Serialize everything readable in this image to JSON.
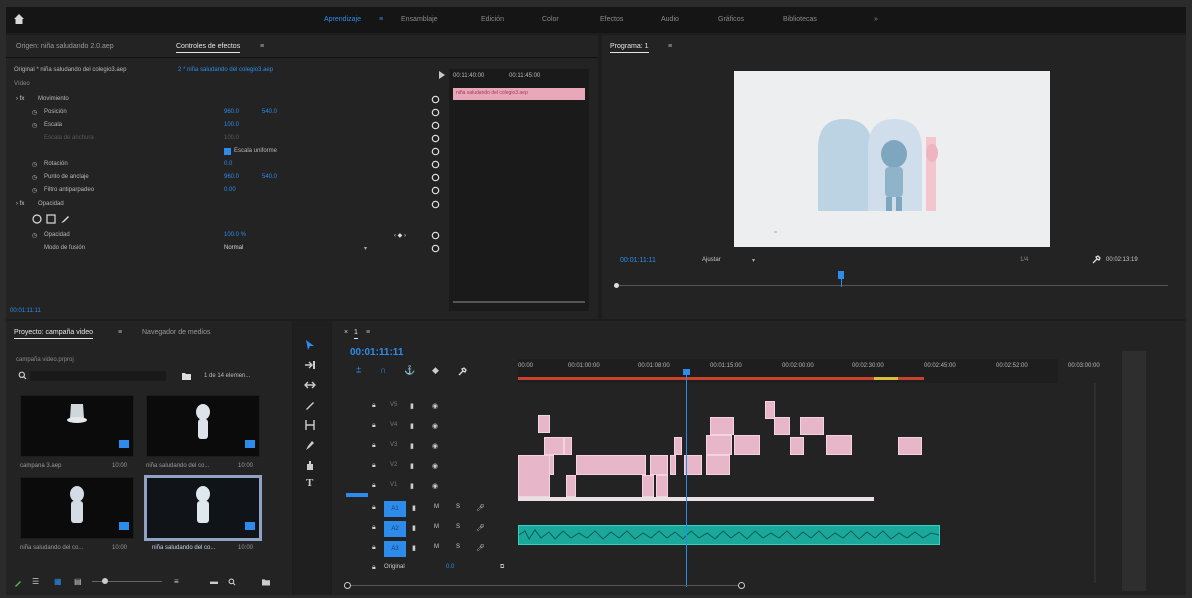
{
  "workspace_bar": {
    "tabs": [
      {
        "label": "Aprendizaje",
        "active": true
      },
      {
        "label": "Ensamblaje",
        "active": false
      },
      {
        "label": "Edición",
        "active": false
      },
      {
        "label": "Color",
        "active": false
      },
      {
        "label": "Efectos",
        "active": false
      },
      {
        "label": "Audio",
        "active": false
      },
      {
        "label": "Gráficos",
        "active": false
      },
      {
        "label": "Bibliotecas",
        "active": false
      }
    ],
    "overflow_label": "»"
  },
  "effect_controls": {
    "tabs": [
      {
        "label": "Origen: niña saludando 2.0.aep"
      },
      {
        "label": "Controles de efectos"
      }
    ],
    "clip_path": "Original * niña saludando del colegio3.aep",
    "clip_target": "2 * niña saludando del colegio3.aep",
    "section_video": "Vídeo",
    "rows": [
      {
        "label": "Movimiento",
        "v1": "",
        "v2": ""
      },
      {
        "label": "Posición",
        "v1": "960.0",
        "v2": "540.0"
      },
      {
        "label": "Escala",
        "v1": "100.0",
        "v2": ""
      },
      {
        "label": "Escala de anchura",
        "v1": "100.0",
        "v2": ""
      },
      {
        "label": "Escala uniforme",
        "v1": "",
        "v2": ""
      },
      {
        "label": "Rotación",
        "v1": "0.0",
        "v2": ""
      },
      {
        "label": "Punto de anclaje",
        "v1": "960.0",
        "v2": "540.0"
      },
      {
        "label": "Filtro antiparpadeo",
        "v1": "0.00",
        "v2": ""
      },
      {
        "label": "Opacidad",
        "v1": "",
        "v2": ""
      },
      {
        "label": "Opacidad",
        "v1": "100.0 %",
        "v2": ""
      },
      {
        "label": "Modo de fusión",
        "v1": "Normal",
        "v2": ""
      }
    ],
    "mini_timeline": {
      "time_start": "00:11:40:00",
      "time_end": "00:11:45:00",
      "clip_label": "niña saludando del colegio3.aep"
    },
    "footer_time": "00:01:11:11"
  },
  "program_monitor": {
    "tab_label": "Programa: 1",
    "current_time": "00:01:11:11",
    "fit_label": "Ajustar",
    "quality_label": "1/4",
    "duration": "00:02:13:19"
  },
  "project": {
    "tabs": [
      {
        "label": "Proyecto: campaña video"
      },
      {
        "label": "Navegador de medios"
      }
    ],
    "project_file": "campaña video.prproj",
    "item_count": "1 de 14 elemen...",
    "items": [
      {
        "name": "campana 3.aep",
        "duration": "10:00"
      },
      {
        "name": "niña saludando del co...",
        "duration": "10:00"
      },
      {
        "name": "niña saludando del co...",
        "duration": "10:00"
      },
      {
        "name": "niña saludando del co...",
        "duration": "10:00"
      }
    ]
  },
  "timeline": {
    "sequence_tab": "1",
    "current_time": "00:01:11:11",
    "ruler": [
      "00:00",
      "00:01:00:00",
      "00:01:08:00",
      "00:01:15:00",
      "00:02:00:00",
      "00:02:30:00",
      "00:02:45:00",
      "00:02:52:00",
      "00:03:00:00"
    ],
    "video_tracks": [
      "V5",
      "V4",
      "V3",
      "V2",
      "V1"
    ],
    "audio_tracks": [
      "A1",
      "A2",
      "A3"
    ],
    "master_label": "Original",
    "master_value": "0.0"
  },
  "colors": {
    "accent": "#2d8ceb",
    "clip_video": "#e7b6c9",
    "clip_audio": "#1aa89b"
  }
}
